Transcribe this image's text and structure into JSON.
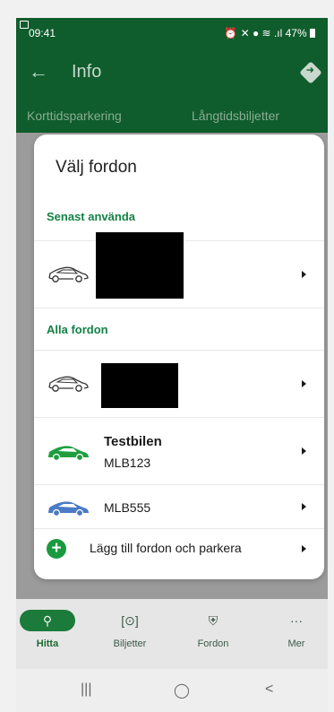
{
  "status_bar": {
    "time": "09:41",
    "icons": "⏰ ✕ ● ≋ .ıl",
    "battery": "47%"
  },
  "header": {
    "back_icon": "←",
    "title": "Info"
  },
  "tabs": [
    "Korttidsparkering",
    "Långtidsbiljetter"
  ],
  "dialog": {
    "title": "Välj fordon",
    "recent_header": "Senast använda",
    "all_header": "Alla fordon",
    "vehicles": [
      {
        "name": "Testbilen",
        "plate": "MLB123",
        "color": "#1f9e3f"
      },
      {
        "plate": "MLB555",
        "color": "#4a7bc4"
      }
    ],
    "add_label": "Lägg till fordon och parkera"
  },
  "bottom_nav": [
    {
      "label": "Hitta",
      "icon": "search-icon"
    },
    {
      "label": "Biljetter",
      "icon": "ticket-icon"
    },
    {
      "label": "Fordon",
      "icon": "car-icon"
    },
    {
      "label": "Mer",
      "icon": "more-icon"
    }
  ]
}
